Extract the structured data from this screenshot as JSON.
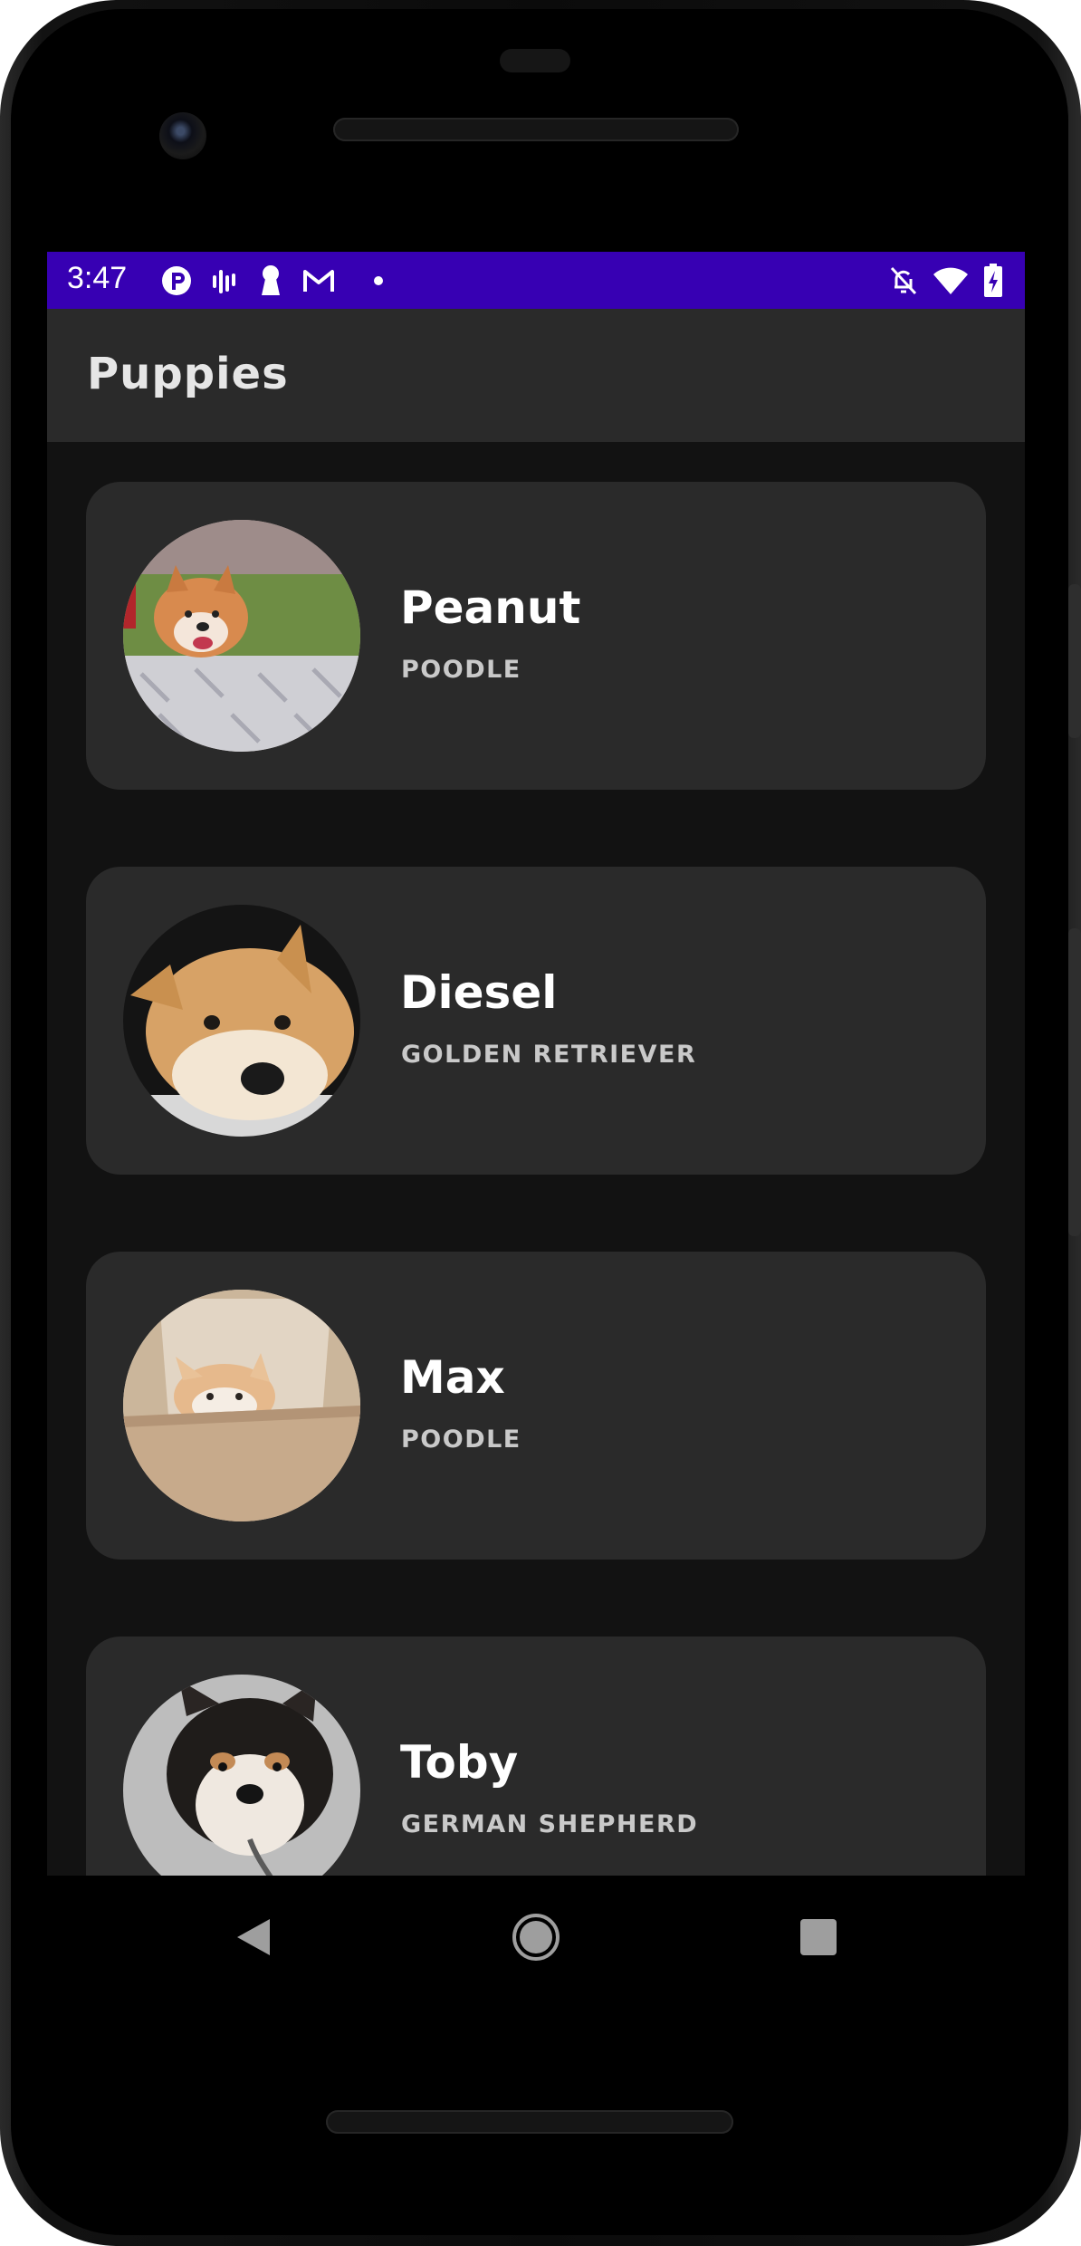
{
  "status_bar": {
    "time": "3:47",
    "left_icons": [
      "p-icon",
      "bars-icon",
      "keyhole-icon",
      "gmail-icon",
      "dot-icon"
    ],
    "right_icons": [
      "bell-off-icon",
      "wifi-icon",
      "battery-charging-icon"
    ]
  },
  "app_bar": {
    "title": "Puppies"
  },
  "puppies": [
    {
      "name": "Peanut",
      "breed": "POODLE"
    },
    {
      "name": "Diesel",
      "breed": "GOLDEN RETRIEVER"
    },
    {
      "name": "Max",
      "breed": "POODLE"
    },
    {
      "name": "Toby",
      "breed": "GERMAN SHEPHERD"
    }
  ],
  "navigation": [
    "back-icon",
    "home-icon",
    "recents-icon"
  ],
  "colors": {
    "status_bar": "#3700b3",
    "app_bar": "#2a2a2a",
    "background": "#121212",
    "card": "#2a2a2a"
  }
}
